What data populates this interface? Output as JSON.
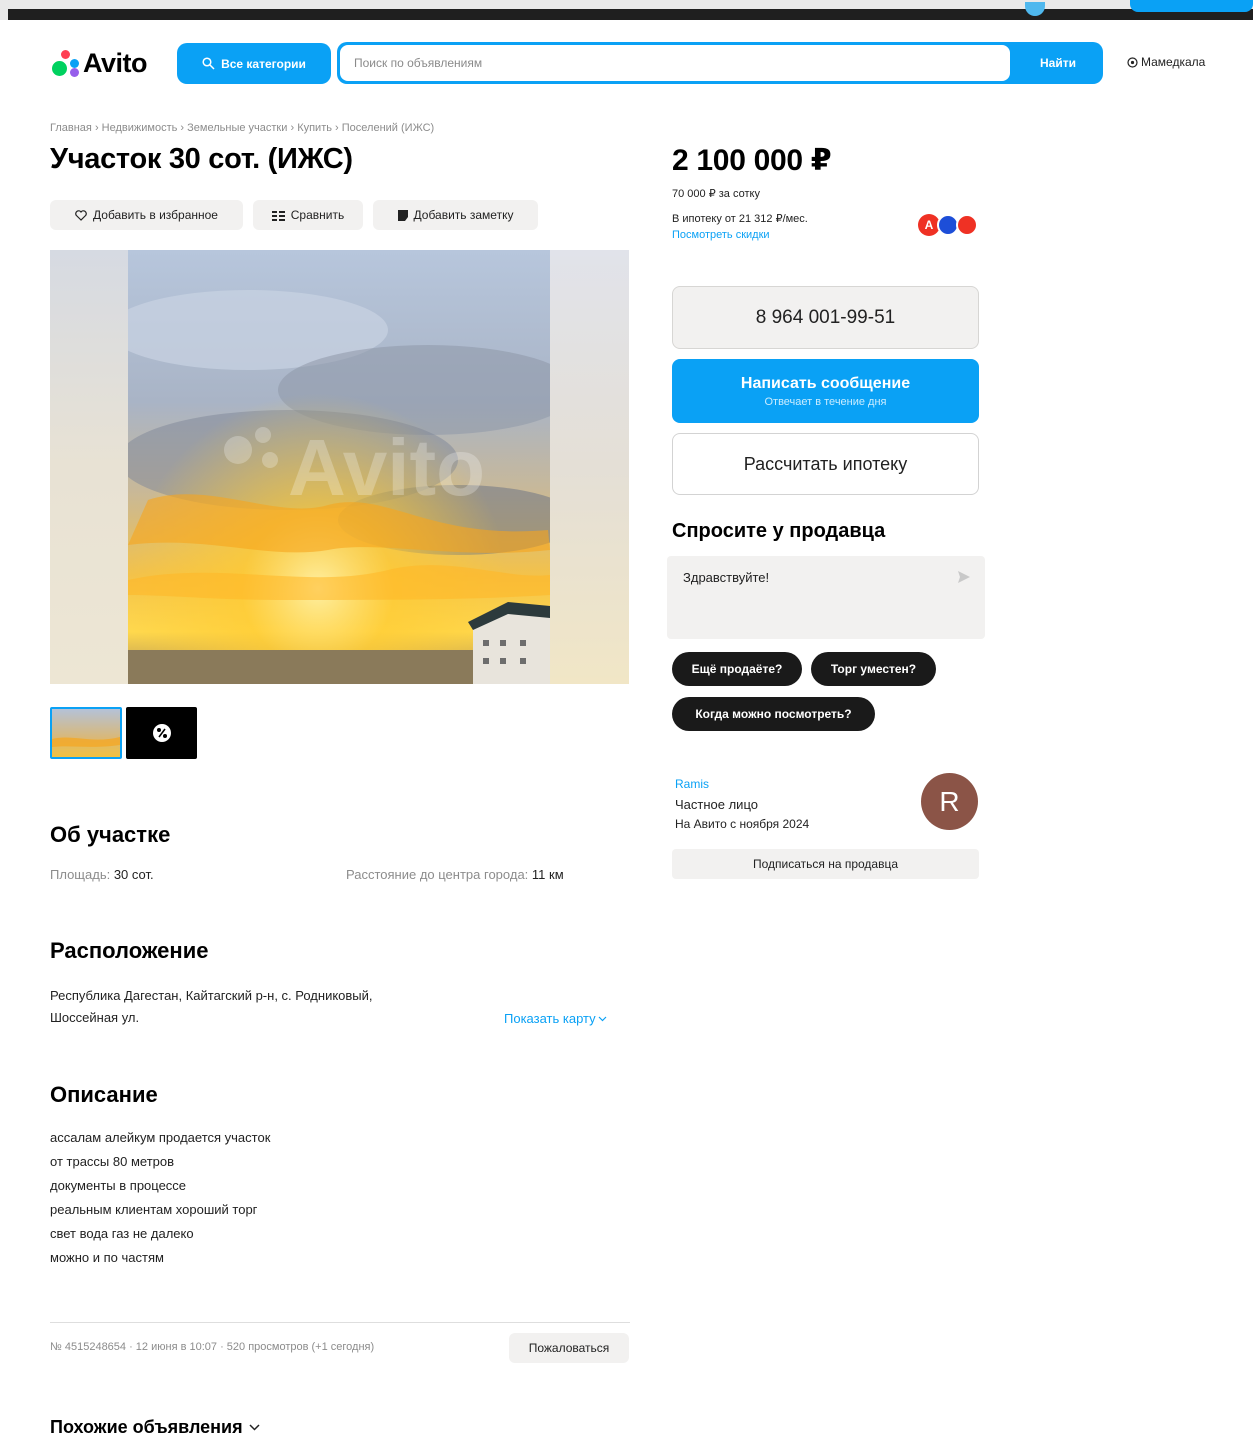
{
  "header": {
    "logo_text": "Avito",
    "categories_button": "Все категории",
    "search_placeholder": "Поиск по объявлениям",
    "search_button": "Найти",
    "location": "Мамедкала"
  },
  "breadcrumb": [
    "Главная",
    "Недвижимость",
    "Земельные участки",
    "Купить",
    "Поселений (ИЖС)"
  ],
  "breadcrumb_separator": "›",
  "listing": {
    "title": "Участок 30 сот. (ИЖС)",
    "actions": {
      "favorite": "Добавить в избранное",
      "compare": "Сравнить",
      "note": "Добавить заметку"
    },
    "watermark": "Avito",
    "about": {
      "heading": "Об участке",
      "area_label": "Площадь:",
      "area_value": "30 сот.",
      "distance_label": "Расстояние до центра города:",
      "distance_value": "11 км"
    },
    "location": {
      "heading": "Расположение",
      "address_line1": "Республика Дагестан, Кайтагский р-н, с. Родниковый,",
      "address_line2": "Шоссейная ул.",
      "show_map": "Показать карту"
    },
    "description": {
      "heading": "Описание",
      "lines": [
        "ассалам алейкум продается участок",
        "от трассы 80 метров",
        "документы в процессе",
        "реальным клиентам хороший торг",
        "свет вода газ не далеко",
        "можно и по частям"
      ]
    },
    "meta": "№ 4515248654 · 12 июня в 10:07 · 520 просмотров (+1 сегодня)",
    "report_button": "Пожаловаться",
    "similar_heading": "Похожие объявления"
  },
  "sidebar": {
    "price": "2 100 000 ₽",
    "price_per_unit": "70 000 ₽ за сотку",
    "mortgage_text": "В ипотеку от 21 312 ₽/мес.",
    "discounts_link": "Посмотреть скидки",
    "phone": "8 964 001-99-51",
    "message_button": "Написать сообщение",
    "message_sub": "Отвечает в течение дня",
    "mortgage_button": "Рассчитать ипотеку",
    "ask_heading": "Спросите у продавца",
    "ask_default": "Здравствуйте!",
    "quick_questions": [
      "Ещё продаёте?",
      "Торг уместен?",
      "Когда можно посмотреть?"
    ],
    "seller": {
      "name": "Ramis",
      "type": "Частное лицо",
      "since": "На Авито с ноября 2024",
      "avatar_letter": "R",
      "subscribe": "Подписаться на продавца"
    }
  },
  "colors": {
    "accent": "#0aa1f5",
    "avatar_bg": "#8b5447",
    "bank_red": "#ef3124",
    "bank_blue": "#1d4ed8"
  }
}
